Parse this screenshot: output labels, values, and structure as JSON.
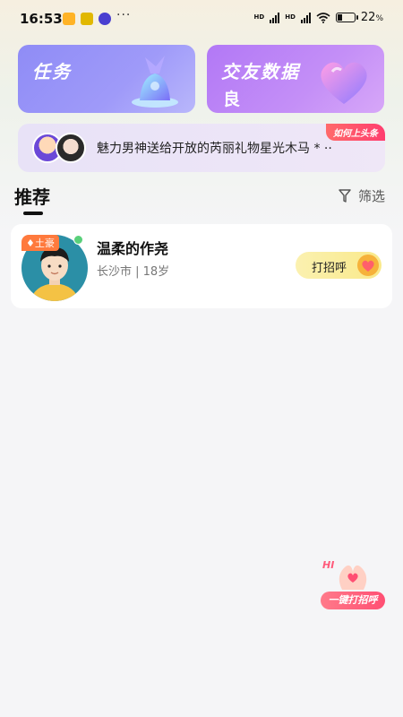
{
  "status_bar": {
    "time": "16:53",
    "overflow": "···",
    "network_hd_1": "HD",
    "network_hd_2": "HD",
    "battery_percent": "22",
    "battery_unit": "%"
  },
  "cards": {
    "task": {
      "title": "任务"
    },
    "social": {
      "title": "交友数据",
      "rating": "良"
    }
  },
  "ticker": {
    "message": "魅力男神送给开放的芮丽礼物星光木马 * ··",
    "badge": "如何上头条"
  },
  "section": {
    "title": "推荐",
    "filter_label": "筛选"
  },
  "user": {
    "badge": "土豪",
    "name": "温柔的作尧",
    "meta": "长沙市 | 18岁",
    "greet_button": "打招呼"
  },
  "floating": {
    "hi": "HI",
    "label": "一键打招呼"
  },
  "colors": {
    "task_card": "#9a96f8",
    "social_card": "#c08af7",
    "greet_button": "#f9e98a",
    "badge_red": "#ff3d6e"
  }
}
